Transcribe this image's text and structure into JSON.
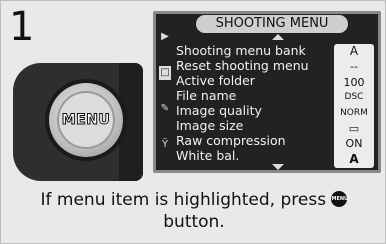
{
  "step": "1",
  "camera": {
    "button_label": "MENU"
  },
  "lcd": {
    "title": "SHOOTING MENU",
    "tabs": [
      "▶",
      "□",
      "◘",
      "✎",
      "Ÿ"
    ],
    "items": [
      "Shooting menu bank",
      "Reset shooting menu",
      "Active folder",
      "File name",
      "Image quality",
      "Image size",
      "Raw compression",
      "White bal."
    ],
    "values": [
      "A",
      "--",
      "100",
      "DSC",
      "NORM",
      "▭",
      "ON",
      "A"
    ]
  },
  "caption": {
    "line1_before": "If menu item is highlighted, press",
    "icon_label": "MENU",
    "line2": "button."
  }
}
